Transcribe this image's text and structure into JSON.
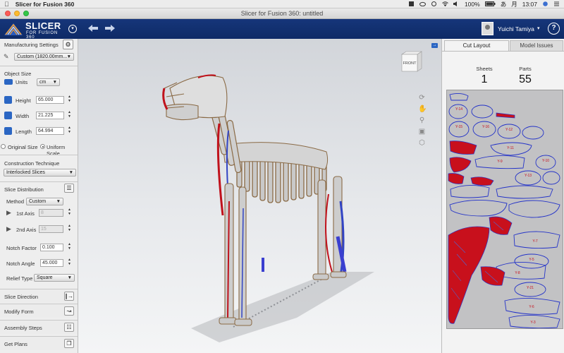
{
  "menubar": {
    "app_name": "Slicer for Fusion 360",
    "clock": "13:07",
    "battery": "100%",
    "ime": "あ",
    "month": "月"
  },
  "window": {
    "title": "Slicer for Fusion 360: untitled"
  },
  "header": {
    "logo_main": "SLICER",
    "logo_sub": "FOR FUSION 360",
    "user_name": "Yuichi Tamiya",
    "help_glyph": "?"
  },
  "left_panel": {
    "manufacturing_settings": "Manufacturing Settings",
    "material_preset": "Custom (1820.00mm...",
    "object_size": {
      "title": "Object Size",
      "units_label": "Units",
      "units_value": "cm",
      "height_label": "Height",
      "height_value": "65.000",
      "width_label": "Width",
      "width_value": "21.225",
      "length_label": "Length",
      "length_value": "64.994",
      "original_size": "Original Size",
      "uniform_scale": "Uniform Scale"
    },
    "construction": {
      "title": "Construction Technique",
      "value": "Interlocked Slices"
    },
    "slice_distribution": {
      "title": "Slice Distribution",
      "method_label": "Method",
      "method_value": "Custom",
      "axis1_label": "1st Axis",
      "axis1_value": "8",
      "axis2_label": "2nd Axis",
      "axis2_value": "15",
      "notch_factor_label": "Notch Factor",
      "notch_factor_value": "0.100",
      "notch_angle_label": "Notch Angle",
      "notch_angle_value": "45.000",
      "relief_type_label": "Relief Type",
      "relief_type_value": "Square"
    },
    "sections": [
      {
        "label": "Slice Direction"
      },
      {
        "label": "Modify Form"
      },
      {
        "label": "Assembly Steps"
      },
      {
        "label": "Get Plans"
      }
    ]
  },
  "viewport": {
    "viewcube_label": "FRONT"
  },
  "right_panel": {
    "tabs": [
      "Cut Layout",
      "Model Issues"
    ],
    "sheets_label": "Sheets",
    "sheets_value": "1",
    "parts_label": "Parts",
    "parts_value": "55",
    "part_labels": [
      "Y-14",
      "Y-15",
      "Y-16",
      "Y-12",
      "Y-11",
      "Y-9",
      "Y-10",
      "Y-13",
      "Y-7",
      "Y-5",
      "Y-8",
      "Y-21",
      "Y-6",
      "Y-3"
    ]
  },
  "colors": {
    "header_blue": "#143174",
    "accent_blue": "#2b66c3",
    "part_fill_red": "#c8101c",
    "part_outline_blue": "#2433c8"
  }
}
